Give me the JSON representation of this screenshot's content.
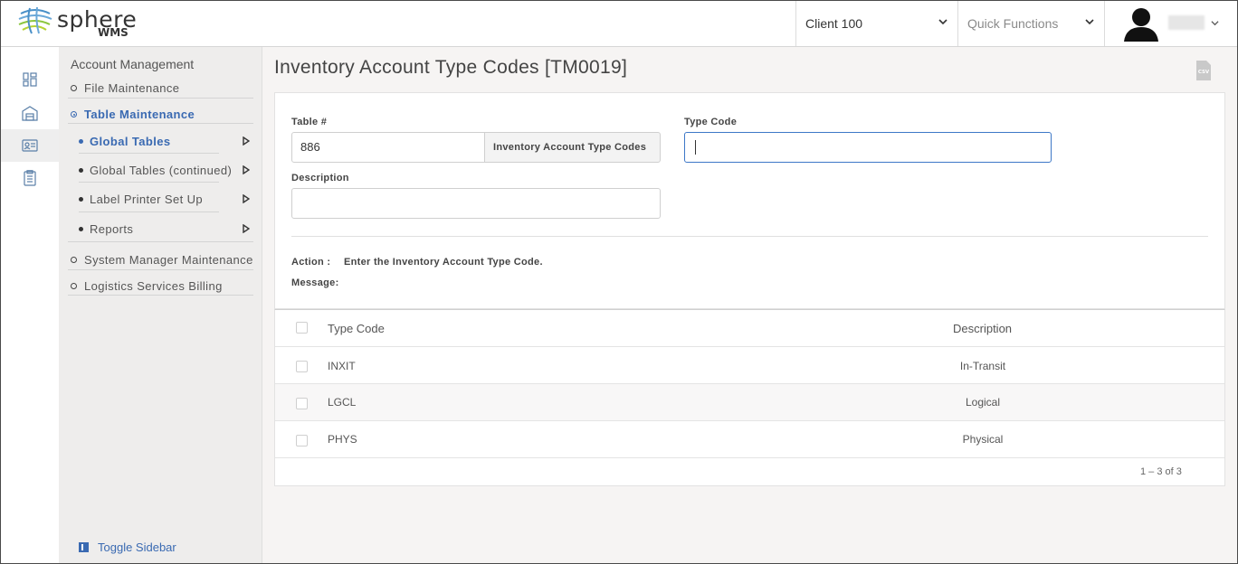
{
  "app": {
    "logo_text": "sphere",
    "logo_sub": "WMS"
  },
  "header": {
    "client": "Client 100",
    "quick_functions_placeholder": "Quick Functions"
  },
  "sidebar": {
    "title": "Account Management",
    "items": [
      {
        "label": "File Maintenance"
      },
      {
        "label": "Table Maintenance"
      },
      {
        "label": "System Manager Maintenance"
      },
      {
        "label": "Logistics Services Billing"
      }
    ],
    "sub_items": [
      {
        "label": "Global Tables"
      },
      {
        "label": "Global Tables (continued)"
      },
      {
        "label": "Label Printer Set Up"
      },
      {
        "label": "Reports"
      }
    ],
    "toggle_label": "Toggle Sidebar"
  },
  "page": {
    "title": "Inventory Account Type Codes [TM0019]",
    "csv_label": "CSV"
  },
  "form": {
    "table_label": "Table #",
    "table_value": "886",
    "table_addon": "Inventory Account Type Codes",
    "type_code_label": "Type Code",
    "type_code_value": "",
    "description_label": "Description",
    "description_value": "",
    "action_label": "Action :",
    "action_value": "Enter the Inventory Account Type Code.",
    "message_label": "Message:"
  },
  "table": {
    "columns": [
      "Type Code",
      "Description"
    ],
    "rows": [
      {
        "code": "INXIT",
        "description": "In-Transit"
      },
      {
        "code": "LGCL",
        "description": "Logical"
      },
      {
        "code": "PHYS",
        "description": "Physical"
      }
    ],
    "pager": "1 – 3 of 3"
  },
  "colors": {
    "accent": "#3a6ab2",
    "focus_border": "#3d78c7"
  }
}
